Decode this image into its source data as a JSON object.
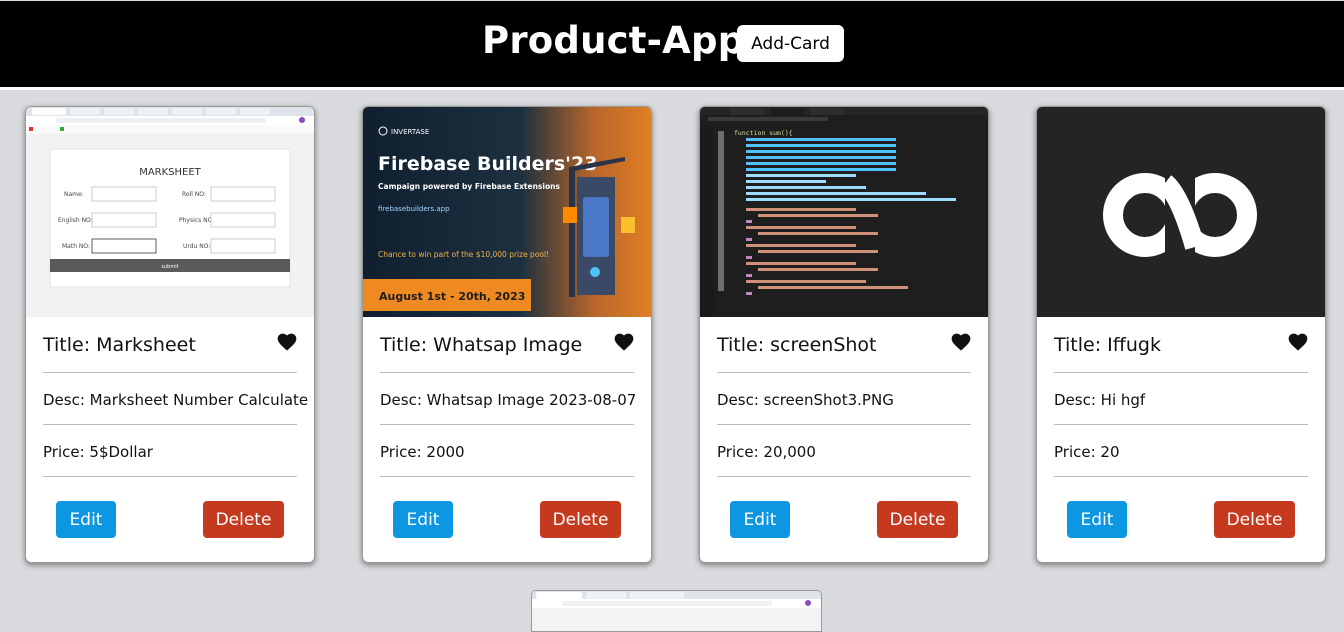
{
  "header": {
    "title": "Product-App",
    "add_button": "Add-Card"
  },
  "cards": [
    {
      "title": "Title: Marksheet",
      "desc": "Desc: Marksheet Number Calculate",
      "price": "Price: 5$Dollar",
      "edit": "Edit",
      "delete": "Delete",
      "image": {
        "heading": "MARKSHEET",
        "labels": [
          "Name:",
          "Roll NO:",
          "English NO:",
          "Physics NO:",
          "Math NO:",
          "Urdu NO:"
        ],
        "submit": "submit"
      }
    },
    {
      "title": "Title: Whatsap Image",
      "desc": "Desc: Whatsap Image 2023-08-07",
      "price": "Price: 2000",
      "edit": "Edit",
      "delete": "Delete",
      "image": {
        "brand": "INVERTASE",
        "headline": "Firebase Builders'23",
        "sub": "Campaign powered by Firebase Extensions",
        "link": "firebasebuilders.app",
        "chance": "Chance to win part of the $10,000 prize pool!",
        "dates": "August 1st - 20th, 2023"
      }
    },
    {
      "title": "Title: screenShot",
      "desc": "Desc: screenShot3.PNG",
      "price": "Price: 20,000",
      "edit": "Edit",
      "delete": "Delete",
      "image": {
        "fn": "function sum(){"
      }
    },
    {
      "title": "Title: Iffugk",
      "desc": "Desc: Hi hgf",
      "price": "Price: 20",
      "edit": "Edit",
      "delete": "Delete"
    }
  ],
  "colors": {
    "edit": "#0d97e3",
    "delete": "#c53a1e",
    "header_bg": "#000000",
    "page_bg": "#d9dadd"
  },
  "icons": {
    "favorite": "heart-icon"
  }
}
